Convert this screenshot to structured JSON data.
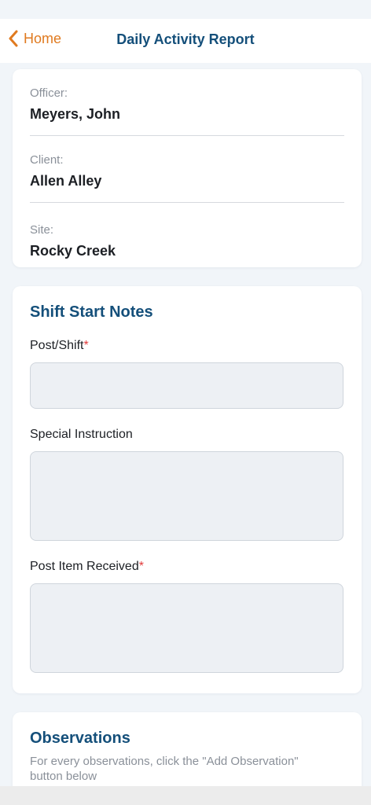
{
  "nav": {
    "back_label": "Home",
    "title": "Daily Activity Report"
  },
  "info": {
    "officer_label": "Officer:",
    "officer_value": "Meyers, John",
    "client_label": "Client:",
    "client_value": "Allen Alley",
    "site_label": "Site:",
    "site_value": "Rocky Creek"
  },
  "shift_start": {
    "title": "Shift Start Notes",
    "post_shift_label": "Post/Shift",
    "post_shift_value": "",
    "special_instruction_label": "Special Instruction",
    "special_instruction_value": "",
    "post_item_label": "Post Item Received",
    "post_item_value": "",
    "required_mark": "*"
  },
  "observations": {
    "title": "Observations",
    "description": "For every observations, click the \"Add Observation\" button below"
  },
  "colors": {
    "accent_orange": "#e07a1f",
    "title_blue": "#144f7a",
    "required_red": "#e23b3b"
  }
}
